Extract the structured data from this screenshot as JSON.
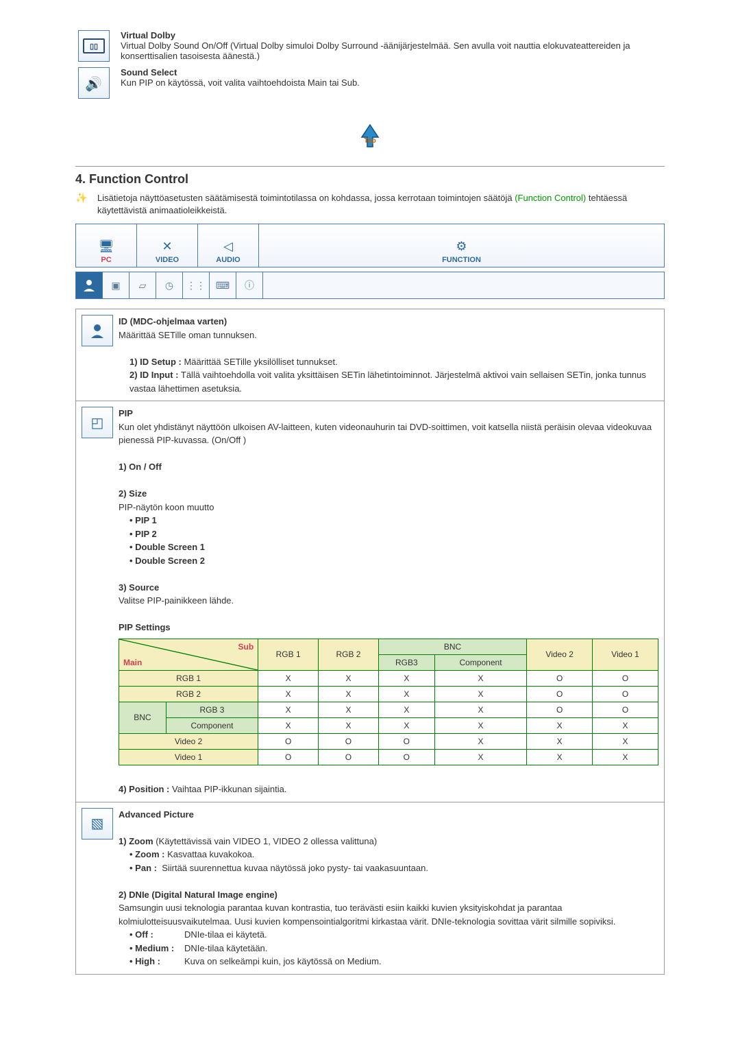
{
  "virtualDolby": {
    "title": "Virtual Dolby",
    "desc": "Virtual Dolby Sound On/Off (Virtual Dolby simuloi Dolby Surround -äänijärjestelmää. Sen avulla voit nauttia elokuvateattereiden ja konserttisalien tasoisesta äänestä.)"
  },
  "soundSelect": {
    "title": "Sound Select",
    "desc": "Kun PIP on käytössä, voit valita vaihtoehdoista Main tai Sub."
  },
  "topLabel": "Top",
  "sectionNum": "4.",
  "sectionTitle": "Function Control",
  "intro": {
    "pre": "Lisätietoja näyttöasetusten säätämisestä toimintotilassa on kohdassa, jossa kerrotaan toimintojen säätöjä ",
    "link": "(Function Control)",
    "post": " tehtäessä käytettävistä animaatioleikkeistä."
  },
  "tabs": {
    "pc": "PC",
    "video": "VIDEO",
    "audio": "AUDIO",
    "function": "FUNCTION"
  },
  "id": {
    "title": "ID (MDC-ohjelmaa varten)",
    "desc": "Määrittää SETille oman tunnuksen.",
    "one_l": "1) ID Setup :",
    "one_d": "Määrittää SETille yksilölliset tunnukset.",
    "two_l": "2) ID Input :",
    "two_d": "Tällä vaihtoehdolla voit valita yksittäisen SETin lähetintoiminnot. Järjestelmä aktivoi vain sellaisen SETin, jonka tunnus vastaa lähettimen asetuksia."
  },
  "pip": {
    "title": "PIP",
    "desc": "Kun olet yhdistänyt näyttöön ulkoisen AV-laitteen, kuten videonauhurin tai DVD-soittimen, voit katsella niistä peräisin olevaa videokuvaa pienessä PIP-kuvassa. (On/Off )",
    "onoff": "1) On / Off",
    "size_t": "2) Size",
    "size_d": "PIP-näytön koon muutto",
    "s1": "• PIP 1",
    "s2": "• PIP 2",
    "s3": "• Double Screen 1",
    "s4": "• Double Screen 2",
    "src_t": "3) Source",
    "src_d": "Valitse PIP-painikkeen lähde.",
    "settings": "PIP Settings",
    "position_l": "4) Position :",
    "position_d": "Vaihtaa PIP-ikkunan sijaintia."
  },
  "table": {
    "main": "Main",
    "sub": "Sub",
    "rgb1": "RGB 1",
    "rgb2": "RGB 2",
    "bnc": "BNC",
    "rgb3": "RGB3",
    "component": "Component",
    "video2": "Video 2",
    "video1": "Video 1",
    "rowlabels": {
      "rgb1": "RGB 1",
      "rgb2": "RGB 2",
      "bnc": "BNC",
      "rgb3": "RGB 3",
      "comp": "Component",
      "v2": "Video 2",
      "v1": "Video 1"
    },
    "rows": [
      {
        "label": "RGB 1",
        "cells": [
          "X",
          "X",
          "X",
          "X",
          "O",
          "O"
        ],
        "cls": "hdr-yellow"
      },
      {
        "label": "RGB 2",
        "cells": [
          "X",
          "X",
          "X",
          "X",
          "O",
          "O"
        ],
        "cls": "hdr-yellow"
      },
      {
        "label": "RGB 3",
        "cells": [
          "X",
          "X",
          "X",
          "X",
          "O",
          "O"
        ],
        "cls": "hdr-green",
        "bnc": true,
        "bncfirst": true
      },
      {
        "label": "Component",
        "cells": [
          "X",
          "X",
          "X",
          "X",
          "X",
          "X"
        ],
        "cls": "hdr-green",
        "bnc": true
      },
      {
        "label": "Video 2",
        "cells": [
          "O",
          "O",
          "O",
          "X",
          "X",
          "X"
        ],
        "cls": "hdr-yellow"
      },
      {
        "label": "Video 1",
        "cells": [
          "O",
          "O",
          "O",
          "X",
          "X",
          "X"
        ],
        "cls": "hdr-yellow"
      }
    ]
  },
  "adv": {
    "title": "Advanced Picture",
    "zoom_t": "1) Zoom",
    "zoom_p": "(Käytettävissä vain VIDEO 1, VIDEO 2 ollessa valittuna)",
    "zoom_l": "• Zoom :",
    "zoom_d": "Kasvattaa kuvakokoa.",
    "pan_l": "• Pan :",
    "pan_d": "Siirtää suurennettua kuvaa näytössä joko pysty- tai vaakasuuntaan.",
    "dnie_t": "2) DNIe (Digital Natural Image engine)",
    "dnie_d": "Samsungin uusi teknologia parantaa kuvan kontrastia, tuo terävästi esiin kaikki kuvien yksityiskohdat ja parantaa kolmiulotteisuusvaikutelmaa. Uusi kuvien kompensointialgoritmi kirkastaa värit. DNIe-teknologia sovittaa värit silmille sopiviksi.",
    "off_l": "• Off :",
    "off_d": "DNIe-tilaa ei käytetä.",
    "med_l": "• Medium :",
    "med_d": "DNIe-tilaa käytetään.",
    "high_l": "• High :",
    "high_d": "Kuva on selkeämpi kuin, jos käytössä on Medium."
  }
}
